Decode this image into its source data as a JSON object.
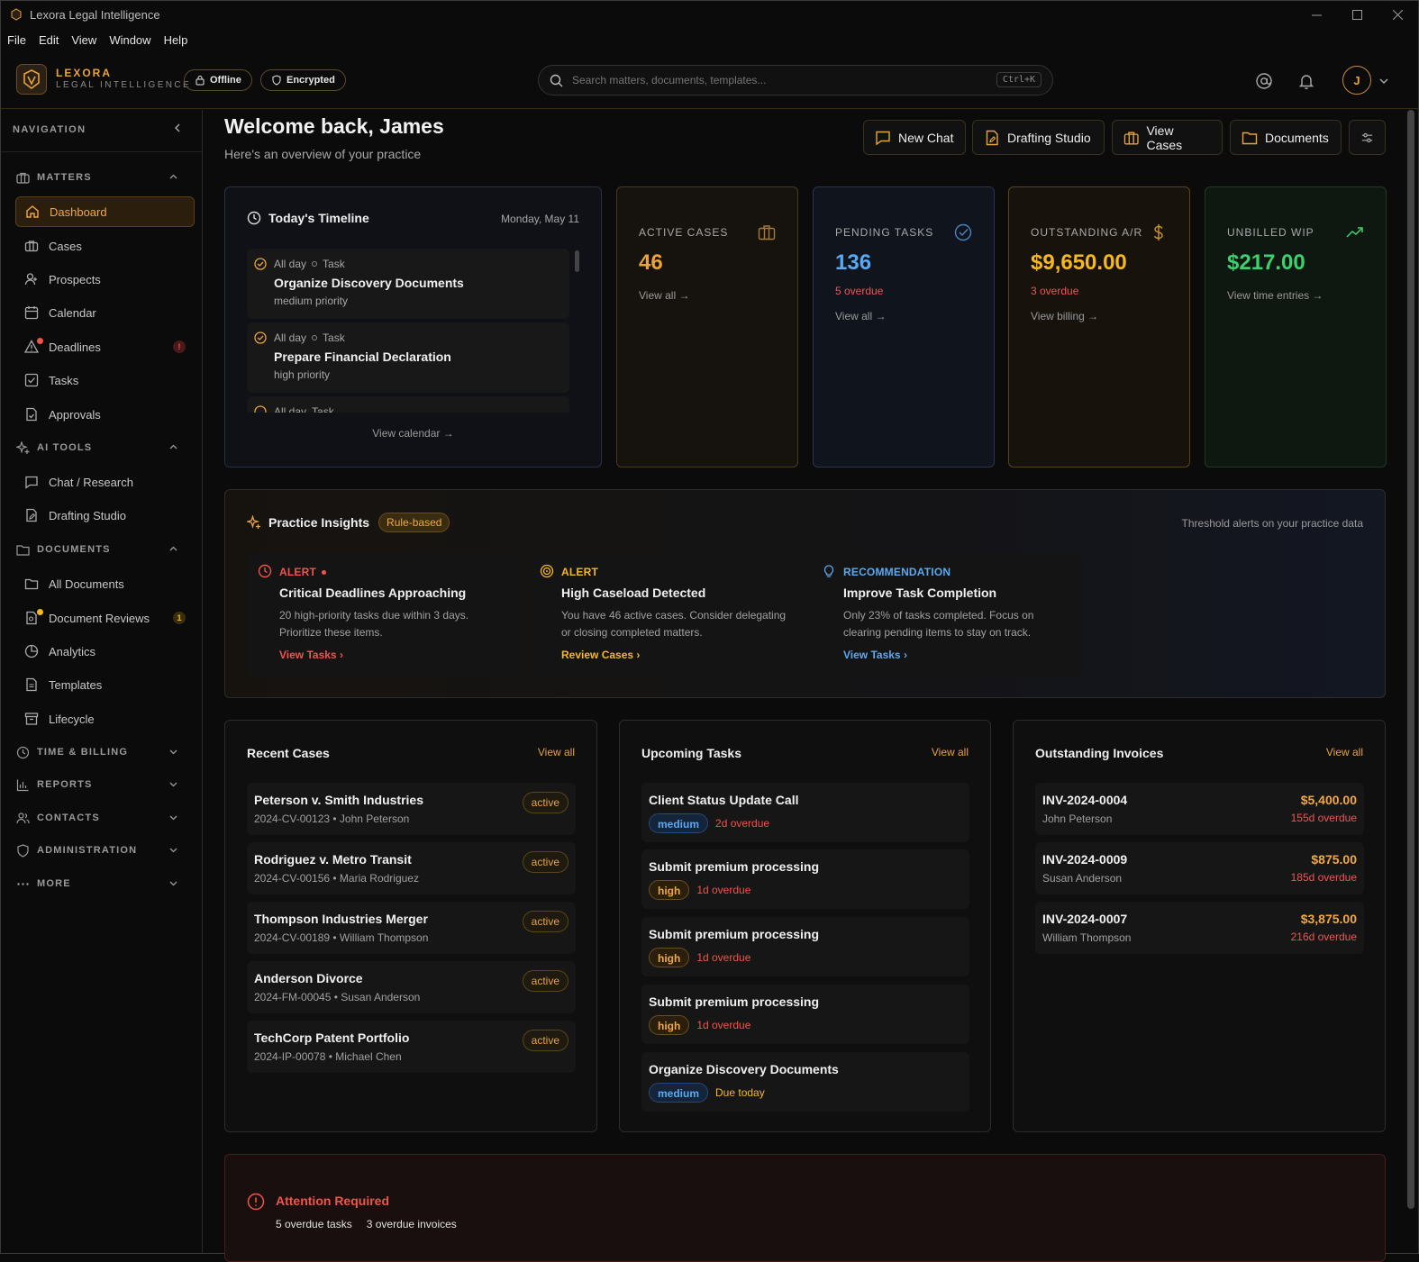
{
  "window": {
    "title": "Lexora Legal Intelligence"
  },
  "menu": [
    "File",
    "Edit",
    "View",
    "Window",
    "Help"
  ],
  "brand": {
    "name": "LEXORA",
    "tagline": "LEGAL INTELLIGENCE",
    "accent": "#e8a33d"
  },
  "status": {
    "offline": "Offline",
    "encrypted": "Encrypted"
  },
  "search": {
    "placeholder": "Search matters, documents, templates...",
    "shortcut": "Ctrl+K"
  },
  "user": {
    "initial": "J"
  },
  "nav": {
    "heading": "NAVIGATION",
    "matters": {
      "label": "MATTERS",
      "items": [
        "Dashboard",
        "Cases",
        "Prospects",
        "Calendar",
        "Deadlines",
        "Tasks",
        "Approvals"
      ],
      "deadlines_badge": "!"
    },
    "ai_tools": {
      "label": "AI TOOLS",
      "items": [
        "Chat / Research",
        "Drafting Studio"
      ]
    },
    "documents": {
      "label": "DOCUMENTS",
      "items": [
        "All Documents",
        "Document Reviews",
        "Analytics",
        "Templates",
        "Lifecycle"
      ],
      "reviews_badge": "1"
    },
    "collapsed": [
      "TIME & BILLING",
      "REPORTS",
      "CONTACTS",
      "ADMINISTRATION",
      "MORE"
    ]
  },
  "header": {
    "title": "Welcome back, James",
    "subtitle": "Here's an overview of your practice"
  },
  "quick": [
    "New Chat",
    "Drafting Studio",
    "View Cases",
    "Documents"
  ],
  "timeline": {
    "title": "Today's Timeline",
    "date": "Monday, May 11",
    "items": [
      {
        "when": "All day",
        "kind": "Task",
        "title": "Organize Discovery Documents",
        "priority": "medium priority"
      },
      {
        "when": "All day",
        "kind": "Task",
        "title": "Prepare Financial Declaration",
        "priority": "high priority"
      },
      {
        "when": "All day",
        "kind": "Task",
        "title": "",
        "priority": ""
      }
    ],
    "link": "View calendar"
  },
  "stats": [
    {
      "label": "ACTIVE CASES",
      "value": "46",
      "note": "",
      "link": "View all",
      "color": "#e8a33d"
    },
    {
      "label": "PENDING TASKS",
      "value": "136",
      "note": "5 overdue",
      "link": "View all",
      "color": "#5aa9f0"
    },
    {
      "label": "OUTSTANDING A/R",
      "value": "$9,650.00",
      "note": "3 overdue",
      "link": "View billing",
      "color": "#f5b820"
    },
    {
      "label": "UNBILLED WIP",
      "value": "$217.00",
      "note": "",
      "link": "View time entries",
      "color": "#3ecf6e"
    }
  ],
  "insights": {
    "title": "Practice Insights",
    "tag": "Rule-based",
    "caption": "Threshold alerts on your practice data",
    "cards": [
      {
        "kind": "ALERT",
        "title": "Critical Deadlines Approaching",
        "desc": "20 high-priority tasks due within 3 days. Prioritize these items.",
        "link": "View Tasks",
        "color": "#f0544a"
      },
      {
        "kind": "ALERT",
        "title": "High Caseload Detected",
        "desc": "You have 46 active cases. Consider delegating or closing completed matters.",
        "link": "Review Cases",
        "color": "#f5b820"
      },
      {
        "kind": "RECOMMENDATION",
        "title": "Improve Task Completion",
        "desc": "Only 23% of tasks completed. Focus on clearing pending items to stay on track.",
        "link": "View Tasks",
        "color": "#5aa9f0"
      }
    ]
  },
  "recent_cases": {
    "title": "Recent Cases",
    "view_all": "View all",
    "rows": [
      {
        "name": "Peterson v. Smith Industries",
        "meta": "2024-CV-00123 • John Peterson",
        "status": "active"
      },
      {
        "name": "Rodriguez v. Metro Transit",
        "meta": "2024-CV-00156 • Maria Rodriguez",
        "status": "active"
      },
      {
        "name": "Thompson Industries Merger",
        "meta": "2024-CV-00189 • William Thompson",
        "status": "active"
      },
      {
        "name": "Anderson Divorce",
        "meta": "2024-FM-00045 • Susan Anderson",
        "status": "active"
      },
      {
        "name": "TechCorp Patent Portfolio",
        "meta": "2024-IP-00078 • Michael Chen",
        "status": "active"
      }
    ]
  },
  "upcoming_tasks": {
    "title": "Upcoming Tasks",
    "view_all": "View all",
    "rows": [
      {
        "name": "Client Status Update Call",
        "priority": "medium",
        "due": "2d overdue"
      },
      {
        "name": "Submit premium processing",
        "priority": "high",
        "due": "1d overdue"
      },
      {
        "name": "Submit premium processing",
        "priority": "high",
        "due": "1d overdue"
      },
      {
        "name": "Submit premium processing",
        "priority": "high",
        "due": "1d overdue"
      },
      {
        "name": "Organize Discovery Documents",
        "priority": "medium",
        "due": "Due today"
      }
    ]
  },
  "invoices": {
    "title": "Outstanding Invoices",
    "view_all": "View all",
    "rows": [
      {
        "id": "INV-2024-0004",
        "client": "John Peterson",
        "amount": "$5,400.00",
        "overdue": "155d overdue"
      },
      {
        "id": "INV-2024-0009",
        "client": "Susan Anderson",
        "amount": "$875.00",
        "overdue": "185d overdue"
      },
      {
        "id": "INV-2024-0007",
        "client": "William Thompson",
        "amount": "$3,875.00",
        "overdue": "216d overdue"
      }
    ]
  },
  "attention": {
    "title": "Attention Required",
    "tasks": "5 overdue tasks",
    "invoices": "3 overdue invoices"
  }
}
